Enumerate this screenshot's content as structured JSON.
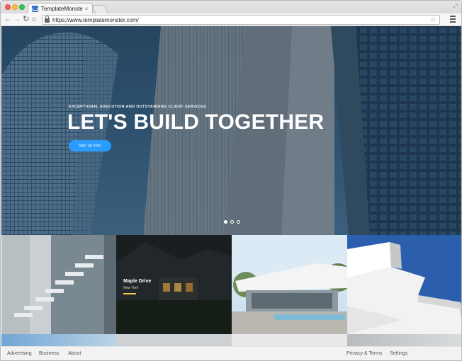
{
  "browser": {
    "tab_title": "TemplateMonster",
    "tab_close": "×",
    "url": "https://www.templatemonster.com/",
    "nav": {
      "back": "←",
      "forward": "→",
      "reload": "↻",
      "home": "⌂",
      "star": "☆",
      "fullscreen": "⤢"
    }
  },
  "hero": {
    "kicker": "EXCEPTIONAL EXECUTION AND OUTSTANDING CLIENT SERVICES",
    "title": "LET'S BUILD TOGETHER",
    "cta": "Sign up now!",
    "slides": 3,
    "active_slide": 1
  },
  "gallery": {
    "featured": {
      "title": "Maple Drive",
      "location": "New York"
    }
  },
  "footer": {
    "left": [
      "Advertising",
      "Business",
      "About"
    ],
    "right": [
      "Privacy & Terms",
      "Settings"
    ]
  },
  "colors": {
    "accent": "#2a9cff",
    "underline": "#f2c94c",
    "hero_sky": "#2b4a63"
  },
  "icons": [
    "lock-icon",
    "star-icon",
    "menu-icon",
    "back-icon",
    "forward-icon",
    "reload-icon",
    "home-icon"
  ]
}
